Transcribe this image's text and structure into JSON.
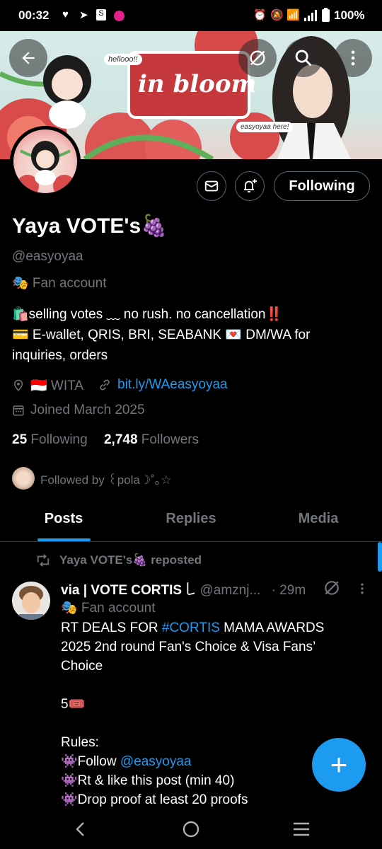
{
  "status_bar": {
    "time": "00:32",
    "notif_icons": [
      "heart-icon",
      "telegram-icon",
      "shopping-bag-icon",
      "app-badge-icon"
    ],
    "right_icons": [
      "alarm-icon",
      "mute-icon",
      "wifi-icon",
      "signal-icon",
      "battery-icon"
    ],
    "battery": "100%"
  },
  "banner": {
    "text_hello": "hellooo!!",
    "text_title": "in bloom",
    "text_signature": "easyoyaa here!"
  },
  "header_actions": {
    "back_icon": "back-arrow-icon",
    "grok_icon": "slash-circle-icon",
    "search_icon": "search-icon",
    "more_icon": "more-vertical-icon"
  },
  "profile": {
    "following_label": "Following",
    "name": "Yaya VOTE's🍇",
    "handle": "@easyoyaa",
    "category": "🎭 Fan account",
    "bio_line1": "🛍️selling votes ﹏ no rush. no cancellation‼️",
    "bio_line2": "💳 E-wallet, QRIS, BRI, SEABANK 💌 DM/WA for inquiries, orders",
    "location": "🇮🇩 WITA",
    "website": "bit.ly/WAeasyoyaa",
    "joined": "Joined March 2025",
    "following_count": "25",
    "following_text": "Following",
    "followers_count": "2,748",
    "followers_text": "Followers",
    "followed_by": "Followed by ꒰pola☽˚｡☆"
  },
  "tabs": [
    {
      "label": "Posts"
    },
    {
      "label": "Replies"
    },
    {
      "label": "Media"
    }
  ],
  "post": {
    "repost_label": "Yaya VOTE's🍇 reposted",
    "author": "via | VOTE CORTIS ꒒",
    "author_handle": "@amznj...",
    "time": "· 29m",
    "category": "🎭 Fan account",
    "line1_prefix": "RT DEALS FOR ",
    "line1_hashtag": "#CORTIS",
    "line1_suffix": " MAMA AWARDS 2025 2nd round Fan's Choice & Visa Fans’ Choice",
    "count_line": "5🎟️",
    "rules_title": "Rules:",
    "rule1_prefix": "👾Follow ",
    "rule1_mention": "@easyoyaa",
    "rule2": "👾Rt & like this post (min 40)",
    "rule3": "👾Drop proof at least 20 proofs"
  },
  "fab": {
    "label": "+"
  },
  "colors": {
    "accent": "#1d9bf0",
    "background": "#000000",
    "muted": "#71767b",
    "text": "#e7e9ea"
  }
}
